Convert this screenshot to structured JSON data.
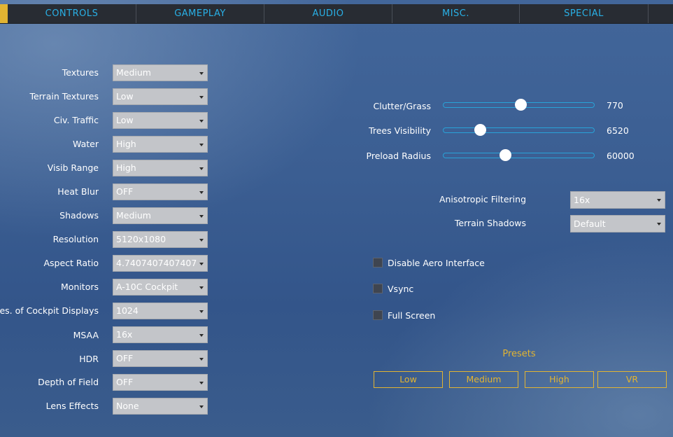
{
  "tabs": [
    {
      "label": "CONTROLS"
    },
    {
      "label": "GAMEPLAY"
    },
    {
      "label": "AUDIO"
    },
    {
      "label": "MISC."
    },
    {
      "label": "SPECIAL"
    }
  ],
  "left_settings": [
    {
      "label": "Textures",
      "value": "Medium"
    },
    {
      "label": "Terrain Textures",
      "value": "Low"
    },
    {
      "label": "Civ. Traffic",
      "value": "Low"
    },
    {
      "label": "Water",
      "value": "High"
    },
    {
      "label": "Visib Range",
      "value": "High"
    },
    {
      "label": "Heat Blur",
      "value": "OFF"
    },
    {
      "label": "Shadows",
      "value": "Medium"
    },
    {
      "label": "Resolution",
      "value": "5120x1080"
    },
    {
      "label": "Aspect Ratio",
      "value": "4.7407407407407"
    },
    {
      "label": "Monitors",
      "value": "A-10C Cockpit"
    },
    {
      "label": "Res. of Cockpit Displays",
      "value": "1024"
    },
    {
      "label": "MSAA",
      "value": "16x"
    },
    {
      "label": "HDR",
      "value": "OFF"
    },
    {
      "label": "Depth of Field",
      "value": "OFF"
    },
    {
      "label": "Lens Effects",
      "value": "None"
    }
  ],
  "sliders": [
    {
      "label": "Clutter/Grass",
      "value": "770",
      "fraction": 0.51
    },
    {
      "label": "Trees Visibility",
      "value": "6520",
      "fraction": 0.24
    },
    {
      "label": "Preload Radius",
      "value": "60000",
      "fraction": 0.41
    }
  ],
  "right_dropdowns": [
    {
      "label": "Anisotropic Filtering",
      "value": "16x"
    },
    {
      "label": "Terrain Shadows",
      "value": "Default"
    }
  ],
  "checkboxes": [
    {
      "label": "Disable Aero Interface",
      "checked": false
    },
    {
      "label": "Vsync",
      "checked": false
    },
    {
      "label": "Full Screen",
      "checked": false
    }
  ],
  "presets": {
    "title": "Presets",
    "buttons": [
      "Low",
      "Medium",
      "High",
      "VR"
    ]
  },
  "colors": {
    "tab_text": "#29b0e6",
    "accent": "#e2b432",
    "slider_track": "#28a3d8"
  }
}
